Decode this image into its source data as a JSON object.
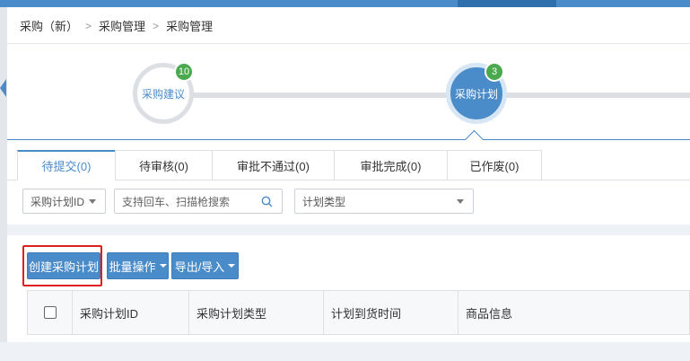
{
  "breadcrumb": [
    "采购（新）",
    "采购管理",
    "采购管理"
  ],
  "steps": [
    {
      "label": "采购建议",
      "badge": "10"
    },
    {
      "label": "采购计划",
      "badge": "3"
    }
  ],
  "tabs": [
    "待提交(0)",
    "待审核(0)",
    "审批不通过(0)",
    "审批完成(0)",
    "已作废(0)"
  ],
  "filters": {
    "id_select": "采购计划ID",
    "search_placeholder": "支持回车、扫描枪搜索",
    "type_select": "计划类型"
  },
  "buttons": {
    "create": "创建采购计划",
    "batch": "批量操作",
    "export": "导出/导入"
  },
  "table": {
    "columns": [
      "采购计划ID",
      "采购计划类型",
      "计划到货时间",
      "商品信息"
    ]
  },
  "colors": {
    "primary": "#4a8bc9",
    "badge": "#4aa94c",
    "highlight": "#e02020"
  }
}
